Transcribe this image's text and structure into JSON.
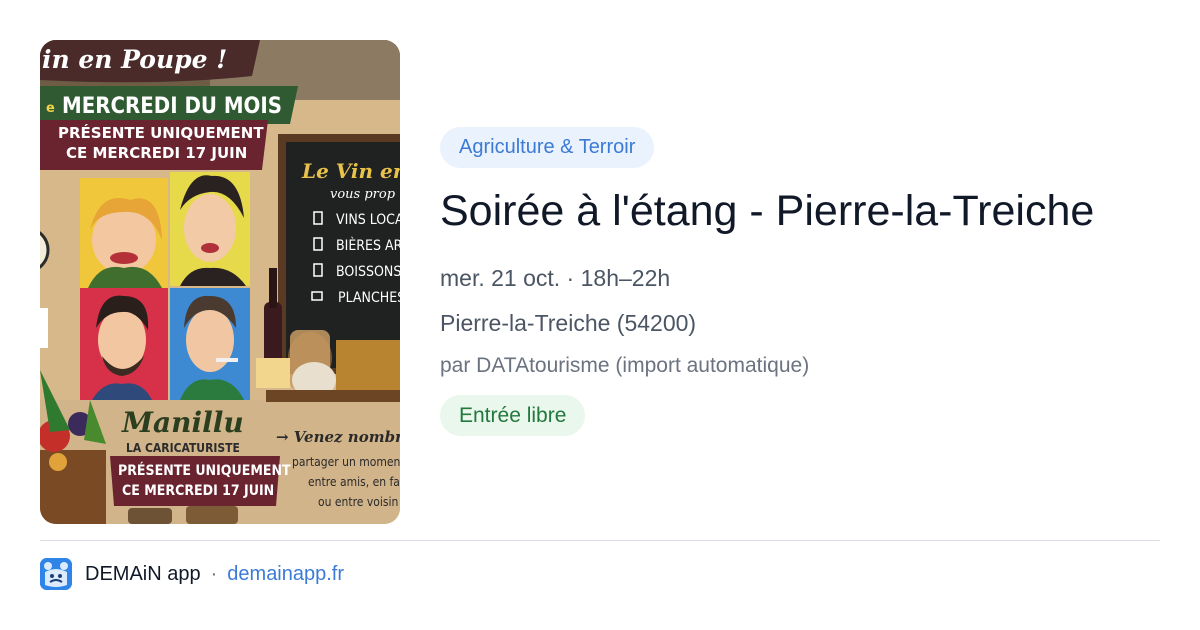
{
  "card": {
    "category": "Agriculture & Terroir",
    "title": "Soirée à l'étang - Pierre-la-Treiche",
    "date": "mer. 21 oct. · 18h–22h",
    "location": "Pierre-la-Treiche (54200)",
    "source": "par DATAtourisme (import automatique)",
    "price": "Entrée libre"
  },
  "poster": {
    "headline": "in en Poupe !",
    "banner": "MERCREDI DU MOIS",
    "banner_prefix": "e",
    "subbanner_line1": "PRÉSENTE UNIQUEMENT",
    "subbanner_line2": "CE MERCREDI 17 JUIN",
    "chalkboard_title": "Le Vin en",
    "chalkboard_sub": "vous prop",
    "chalkboard_items": [
      "VINS LOCAU",
      "BIÈRES ART",
      "BOISSONS S",
      "PLANCHES"
    ],
    "artist_name": "Manillu",
    "artist_role": "LA CARICATURISTE",
    "bottom_line1": "PRÉSENTE UNIQUEMENT",
    "bottom_line2": "CE MERCREDI 17 JUIN",
    "cta": "→ Venez nombr",
    "cta_lines": [
      "partager un momen",
      "entre amis, en fa",
      "ou entre voisin"
    ]
  },
  "footer": {
    "app_name": "DEMAiN app",
    "separator": "·",
    "domain": "demainapp.fr"
  },
  "colors": {
    "accent_blue": "#3b7bd6",
    "badge_blue_bg": "#eaf2fd",
    "badge_green_bg": "#e9f7ec",
    "badge_green_text": "#23783d",
    "logo_blue": "#2f84e8"
  }
}
